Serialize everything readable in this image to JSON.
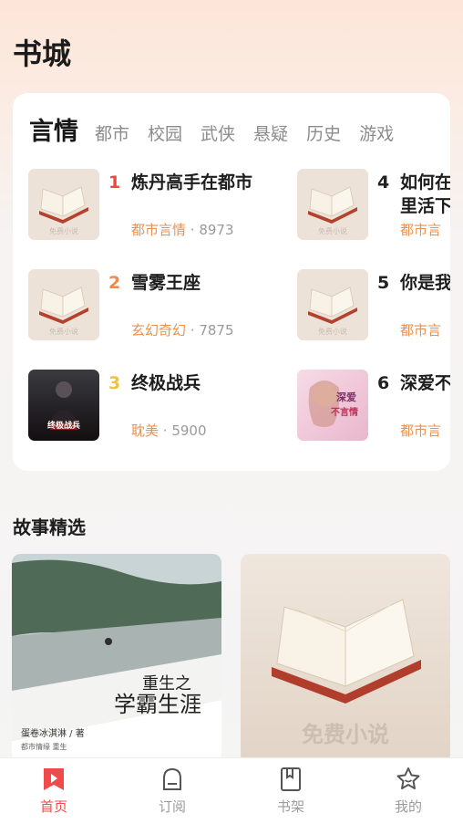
{
  "header": {
    "title": "书城"
  },
  "categories": {
    "tabs": [
      {
        "label": "言情",
        "active": true
      },
      {
        "label": "都市"
      },
      {
        "label": "校园"
      },
      {
        "label": "武侠"
      },
      {
        "label": "悬疑"
      },
      {
        "label": "历史"
      },
      {
        "label": "游戏"
      }
    ]
  },
  "rank_list": [
    {
      "rank": "1",
      "title": "炼丹高手在都市",
      "category": "都市言情",
      "count": "8973",
      "cover": "book-placeholder",
      "rank_color": "#e84a3c"
    },
    {
      "rank": "2",
      "title": "雪雾王座",
      "category": "玄幻奇幻",
      "count": "7875",
      "cover": "book-placeholder",
      "rank_color": "#f08a45"
    },
    {
      "rank": "3",
      "title": "终极战兵",
      "category": "耽美",
      "count": "5900",
      "cover": "dark-warrior",
      "rank_color": "#f2c23c",
      "cover_text": "终极战兵"
    },
    {
      "rank": "4",
      "title": "如何在\n里活下",
      "category": "都市言",
      "count": "",
      "cover": "book-placeholder",
      "rank_color": "#222"
    },
    {
      "rank": "5",
      "title": "你是我",
      "category": "都市言",
      "count": "",
      "cover": "book-placeholder",
      "rank_color": "#222"
    },
    {
      "rank": "6",
      "title": "深爱不",
      "category": "都市言",
      "count": "",
      "cover": "romance-girl",
      "rank_color": "#222",
      "cover_text_1": "深爱",
      "cover_text_2": "不言情"
    }
  ],
  "stories": {
    "title": "故事精选",
    "items": [
      {
        "cover": "landscape",
        "heading_1": "重生之",
        "heading_2": "学霸生涯",
        "author": "蛋卷冰淇淋 / 著",
        "tag": "都市情缘  重生"
      },
      {
        "cover": "book-placeholder",
        "watermark": "免费小说"
      }
    ]
  },
  "placeholder_watermark": "免费小说",
  "bottom_nav": [
    {
      "label": "首页",
      "icon": "home-bookmark-icon",
      "active": true
    },
    {
      "label": "订阅",
      "icon": "subscribe-icon"
    },
    {
      "label": "书架",
      "icon": "bookshelf-icon"
    },
    {
      "label": "我的",
      "icon": "profile-star-icon"
    }
  ],
  "colors": {
    "accent": "#f04b4b",
    "meta": "#e89150",
    "muted": "#9b9b9b"
  }
}
